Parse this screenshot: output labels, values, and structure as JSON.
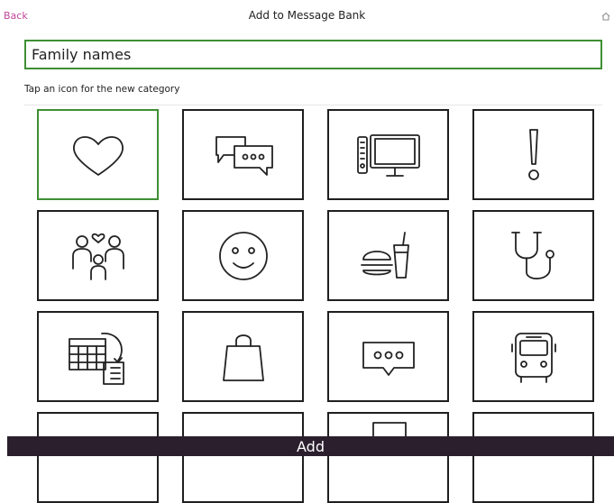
{
  "header": {
    "back_label": "Back",
    "title": "Add to Message Bank",
    "home_icon": "home-icon"
  },
  "category_name": {
    "value": "Family names"
  },
  "hint": "Tap an icon for the new category",
  "icons": [
    {
      "name": "heart-icon",
      "selected": true
    },
    {
      "name": "speech-bubbles-icon"
    },
    {
      "name": "tv-remote-icon"
    },
    {
      "name": "exclamation-icon"
    },
    {
      "name": "family-icon"
    },
    {
      "name": "smiley-face-icon"
    },
    {
      "name": "burger-drink-icon"
    },
    {
      "name": "stethoscope-icon"
    },
    {
      "name": "calendar-schedule-icon"
    },
    {
      "name": "shopping-bag-icon"
    },
    {
      "name": "chat-bubble-icon"
    },
    {
      "name": "bus-icon"
    },
    {
      "name": "partial-icon"
    },
    {
      "name": "partial-icon"
    },
    {
      "name": "partial-icon"
    },
    {
      "name": "partial-icon"
    }
  ],
  "add_button_label": "Add",
  "colors": {
    "accent_green": "#3f8f33",
    "back_link": "#c0479a",
    "add_bar": "#2b1f2e"
  }
}
